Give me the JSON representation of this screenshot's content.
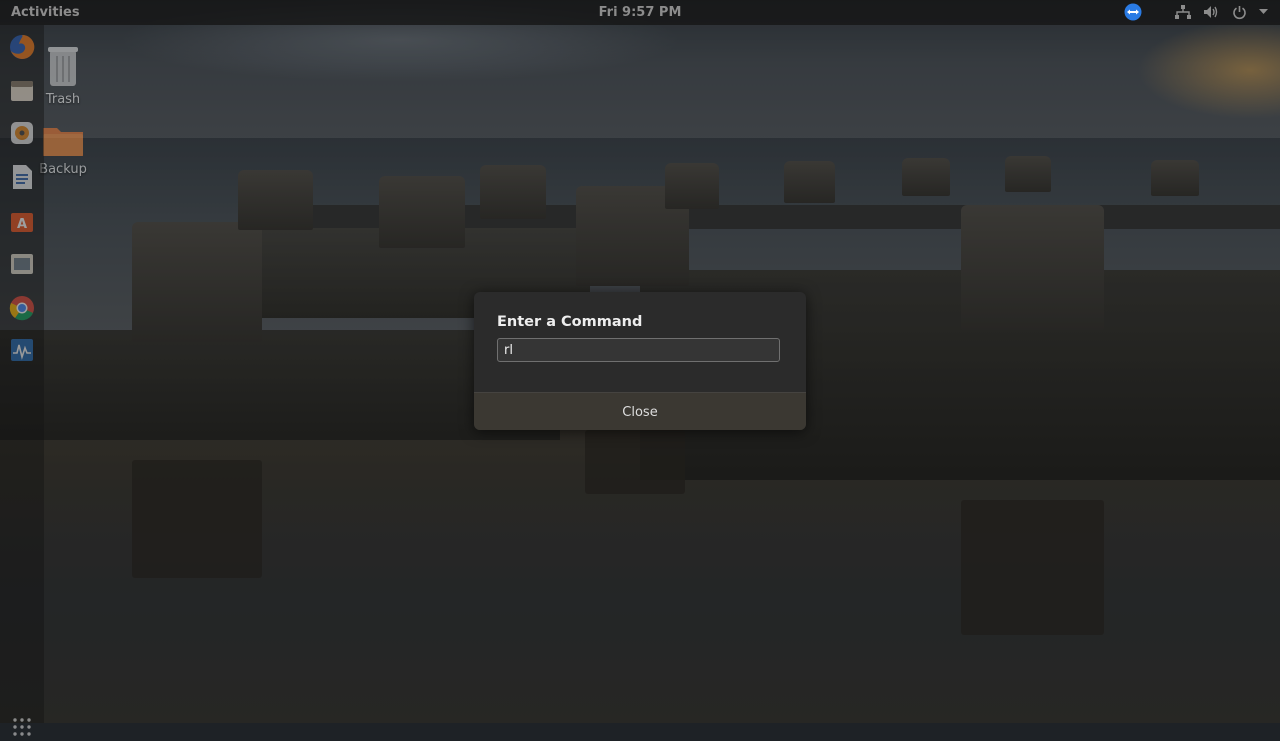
{
  "topbar": {
    "activities_label": "Activities",
    "clock": "Fri  9:57 PM",
    "tray_icons": [
      "teamviewer-icon",
      "network-icon",
      "volume-icon",
      "power-icon",
      "menu-arrow-icon"
    ]
  },
  "dock": {
    "items": [
      "firefox-icon",
      "files-icon",
      "rhythmbox-icon",
      "libreoffice-writer-icon",
      "software-center-icon",
      "screenshot-app-icon",
      "chrome-icon",
      "system-monitor-icon"
    ],
    "show_apps_icon": "apps-grid-icon"
  },
  "desktop": {
    "icons": [
      {
        "label": "Trash",
        "icon": "trash-icon"
      },
      {
        "label": "Backup",
        "icon": "folder-icon"
      }
    ]
  },
  "dialog": {
    "title": "Enter a Command",
    "input_value": "rl",
    "close_label": "Close"
  },
  "colors": {
    "dialog_bg": "#2b2b2b",
    "dialog_footer_bg": "#3b3832",
    "topbar_bg": "#141414",
    "accent_orange": "#e95420"
  }
}
